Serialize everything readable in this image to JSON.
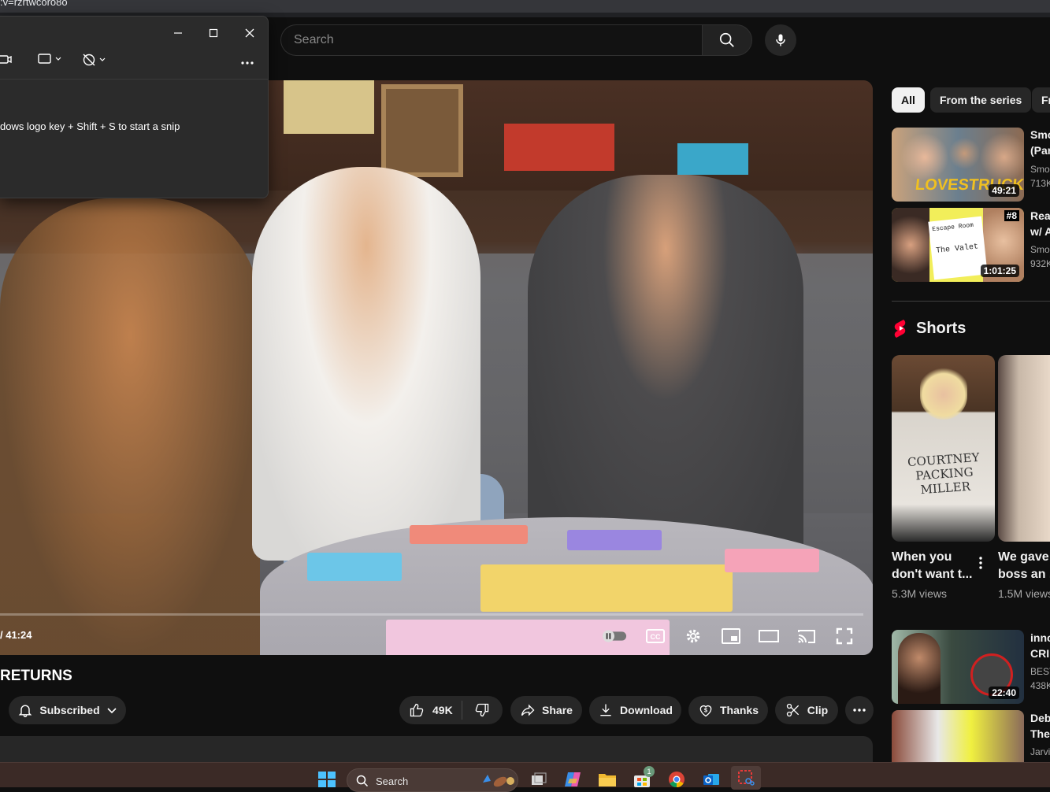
{
  "browser": {
    "url_fragment": ":v=rzrtwcoro8o"
  },
  "search": {
    "placeholder": "Search"
  },
  "snip_tool": {
    "hint": "dows logo key + Shift + S to start a snip"
  },
  "player": {
    "time": "/ 41:24",
    "progress_fraction": 0.0
  },
  "video": {
    "title": "RETURNS",
    "subscribed_label": "Subscribed",
    "likes": "49K",
    "share_label": "Share",
    "download_label": "Download",
    "thanks_label": "Thanks",
    "clip_label": "Clip"
  },
  "sidebar": {
    "chips": [
      "All",
      "From the series",
      "Fr"
    ],
    "videos": [
      {
        "title1": "Smo",
        "title2": "(Par",
        "channel": "Smos",
        "views": "713K",
        "duration": "49:21",
        "thumb_text": "LOVESTRUCK"
      },
      {
        "title1": "Reac",
        "title2": "w/ A",
        "channel": "Smos",
        "views": "932K",
        "duration": "1:01:25",
        "thumb_text": "Escape Room",
        "thumb_text2": "The Valet",
        "badge": "#8"
      },
      {
        "title1": "inno",
        "title2": "CRIM",
        "channel": "BEST",
        "views": "438K",
        "duration": "22:40"
      },
      {
        "title1": "Deb",
        "title2": "The",
        "channel": "Jarvi",
        "views": ""
      }
    ],
    "shorts_heading": "Shorts",
    "shorts": [
      {
        "title1": "When you",
        "title2": "don't want t...",
        "views": "5.3M views",
        "shirt_text": "COURTNEY PACKING MILLER"
      },
      {
        "title1": "We gave",
        "title2": "boss an ...",
        "views": "1.5M views"
      }
    ]
  },
  "taskbar": {
    "search_label": "Search",
    "badge_count": "1"
  },
  "colors": {
    "background": "#0f0f0f",
    "shorts_red": "#ff0033",
    "taskbar": "#3b2a26"
  }
}
